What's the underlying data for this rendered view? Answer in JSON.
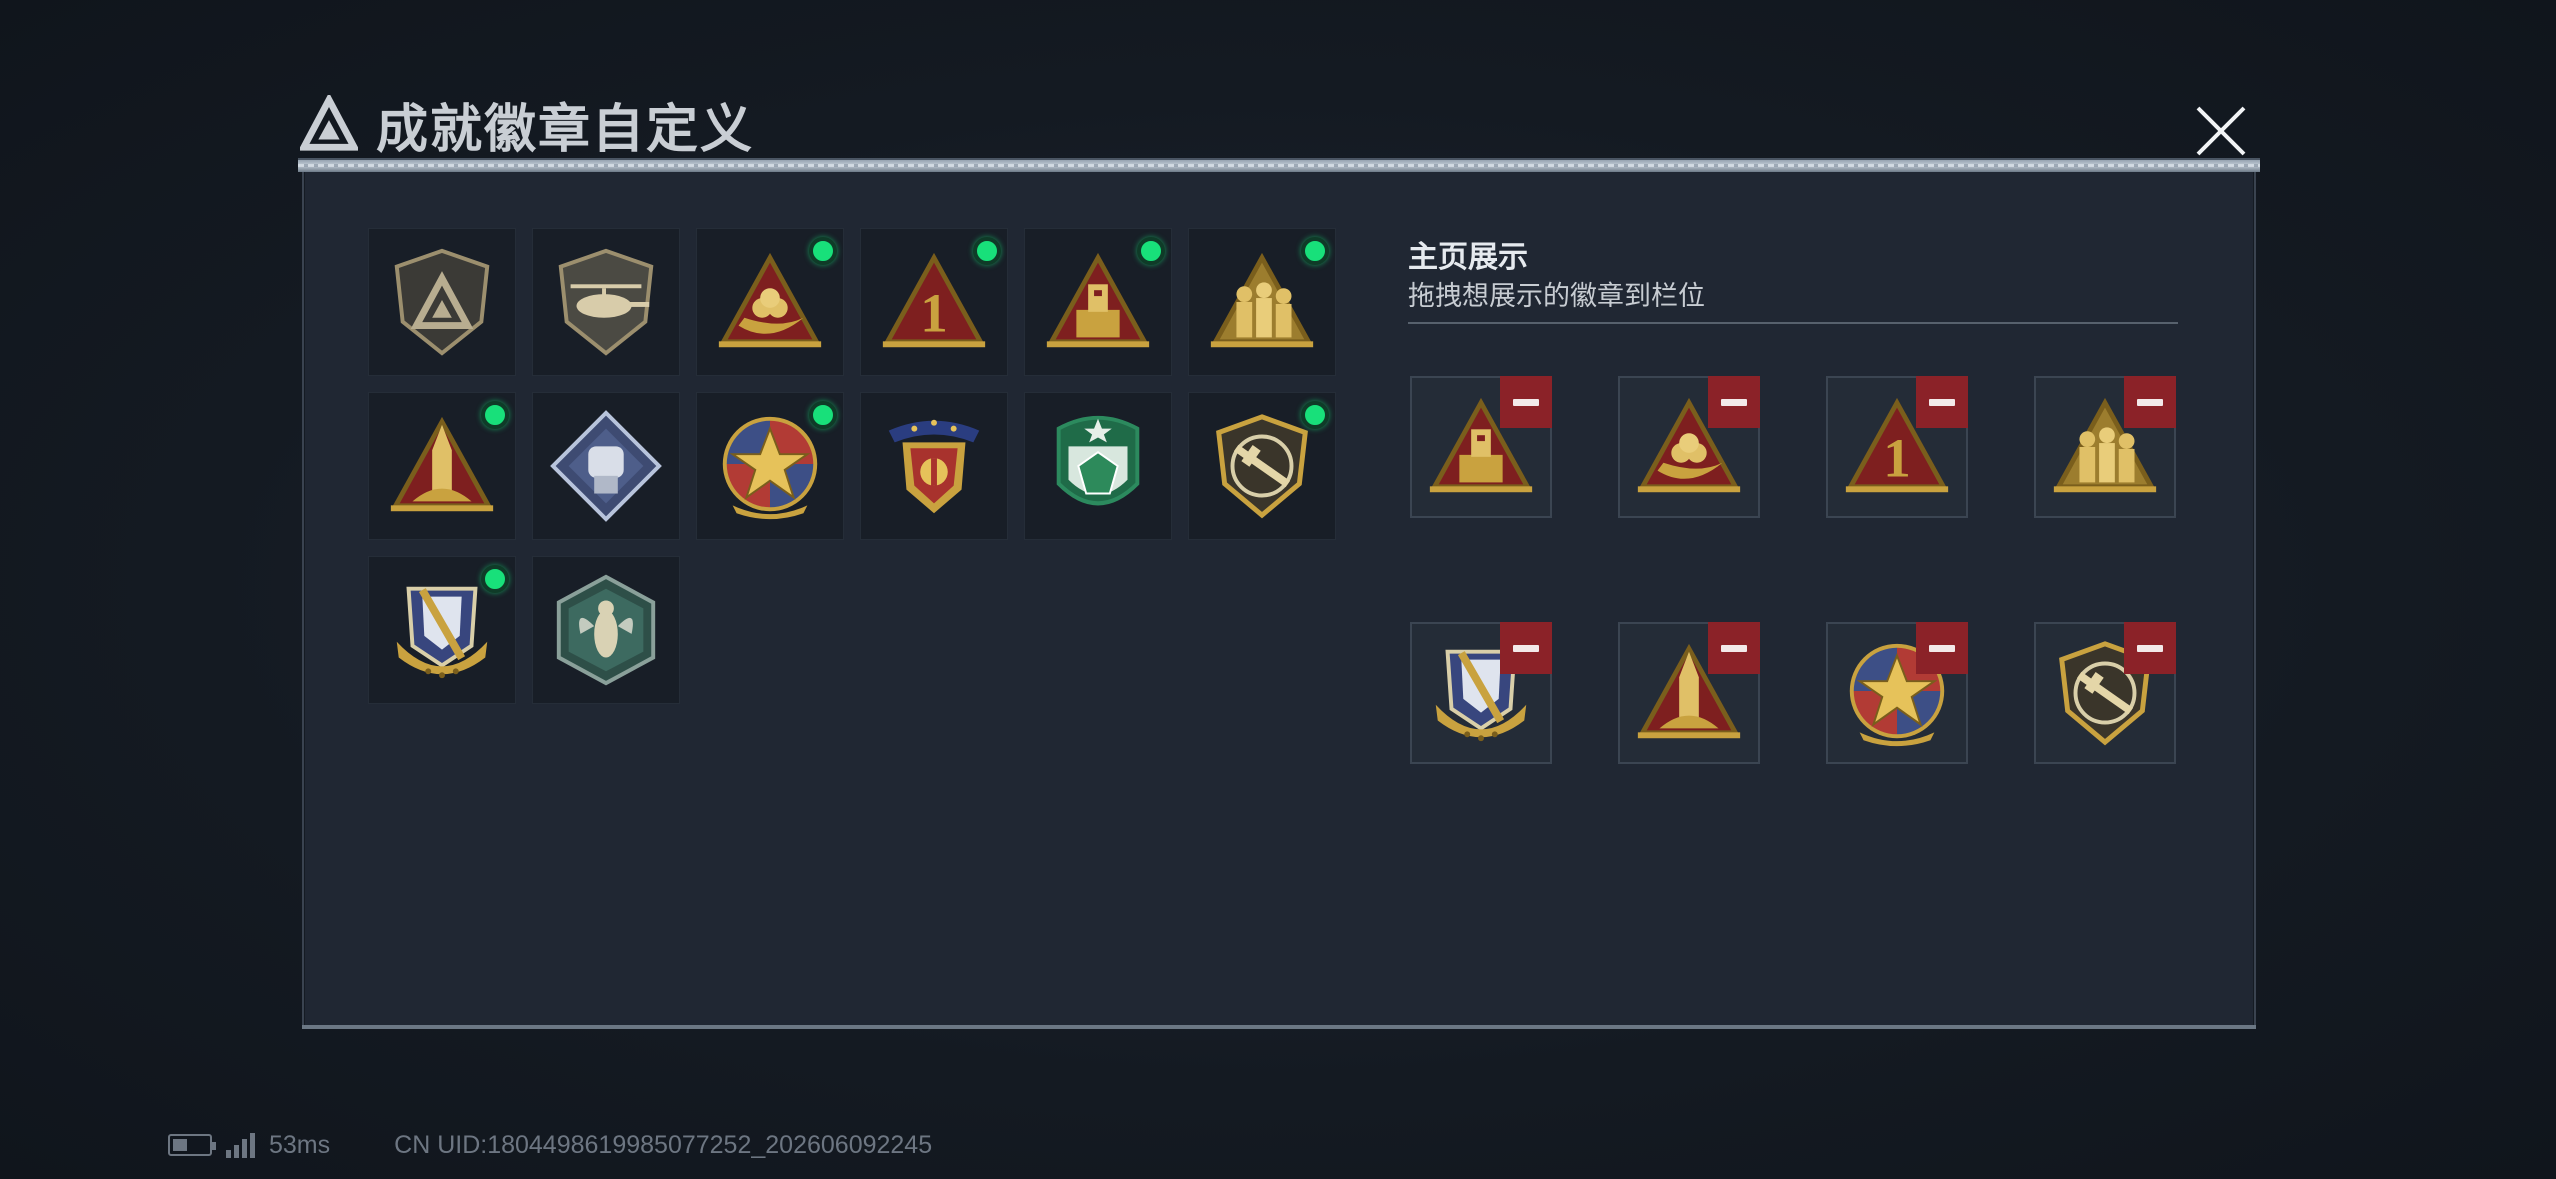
{
  "header": {
    "title": "成就徽章自定义",
    "close_label": "×"
  },
  "badges": [
    {
      "id": "shield-triangle",
      "new": false
    },
    {
      "id": "helicopter",
      "new": false
    },
    {
      "id": "triangle-nest",
      "new": true
    },
    {
      "id": "triangle-number-one",
      "new": true
    },
    {
      "id": "triangle-totem",
      "new": true
    },
    {
      "id": "triangle-soldiers",
      "new": true
    },
    {
      "id": "triangle-rocket",
      "new": true
    },
    {
      "id": "diamond-fist",
      "new": false
    },
    {
      "id": "star-wreath",
      "new": true
    },
    {
      "id": "winged-crest",
      "new": false
    },
    {
      "id": "green-gem-shield",
      "new": false
    },
    {
      "id": "rifle-shield",
      "new": true
    },
    {
      "id": "sword-wreath",
      "new": true
    },
    {
      "id": "hexagon-wasp",
      "new": false
    }
  ],
  "showcase": {
    "title": "主页展示",
    "subtitle": "拖拽想展示的徽章到栏位",
    "slots": [
      {
        "badge": "triangle-totem"
      },
      {
        "badge": "triangle-nest"
      },
      {
        "badge": "triangle-number-one"
      },
      {
        "badge": "triangle-soldiers"
      },
      {
        "badge": "sword-wreath"
      },
      {
        "badge": "triangle-rocket"
      },
      {
        "badge": "star-wreath"
      },
      {
        "badge": "rifle-shield"
      }
    ]
  },
  "status": {
    "latency": "53ms",
    "uid": "CN UID:18044986199850772​52_202606092245"
  },
  "colors": {
    "accent_new": "#18e07a",
    "remove": "#8b2228",
    "panel": "#202733"
  }
}
